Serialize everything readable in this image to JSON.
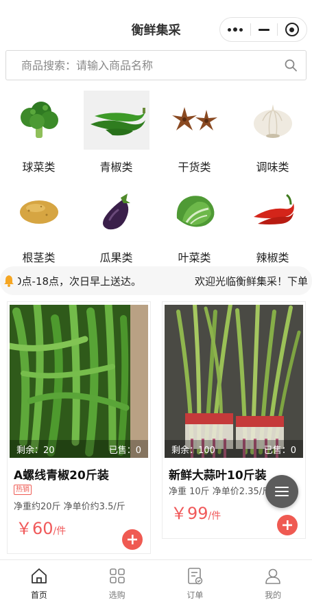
{
  "header": {
    "title": "衡鲜集采"
  },
  "search": {
    "placeholder": "商品搜索：请输入商品名称"
  },
  "categories": [
    {
      "label": "球菜类",
      "icon": "broccoli-icon"
    },
    {
      "label": "青椒类",
      "icon": "green-pepper-icon"
    },
    {
      "label": "干货类",
      "icon": "star-anise-icon"
    },
    {
      "label": "调味类",
      "icon": "garlic-icon"
    },
    {
      "label": "根茎类",
      "icon": "potato-icon"
    },
    {
      "label": "瓜果类",
      "icon": "eggplant-icon"
    },
    {
      "label": "叶菜类",
      "icon": "cabbage-icon"
    },
    {
      "label": "辣椒类",
      "icon": "red-chili-icon"
    }
  ],
  "notice": {
    "part1": "0点-18点，次日早上送达。",
    "part2": "欢迎光临衡鲜集采！下单"
  },
  "products": [
    {
      "name": "A螺线青椒20斤装",
      "tag": "热销",
      "spec": "净重约20斤 净单价约3.5/斤",
      "remaining": "剩余：20",
      "sold": "已售：0",
      "price": "￥60",
      "unit": "/件"
    },
    {
      "name": "新鲜大蒜叶10斤装",
      "spec": "净重 10斤 净单价2.35/斤",
      "remaining": "剩余：100",
      "sold": "已售：0",
      "price": "￥99",
      "unit": "/件"
    }
  ],
  "tabbar": [
    {
      "label": "首页",
      "icon": "home-icon",
      "active": true
    },
    {
      "label": "选购",
      "icon": "grid-icon"
    },
    {
      "label": "订单",
      "icon": "order-icon"
    },
    {
      "label": "我的",
      "icon": "user-icon"
    }
  ],
  "colors": {
    "accent": "#ef5a52",
    "tag": "#ee5a52",
    "fab": "#5c5c5c"
  }
}
